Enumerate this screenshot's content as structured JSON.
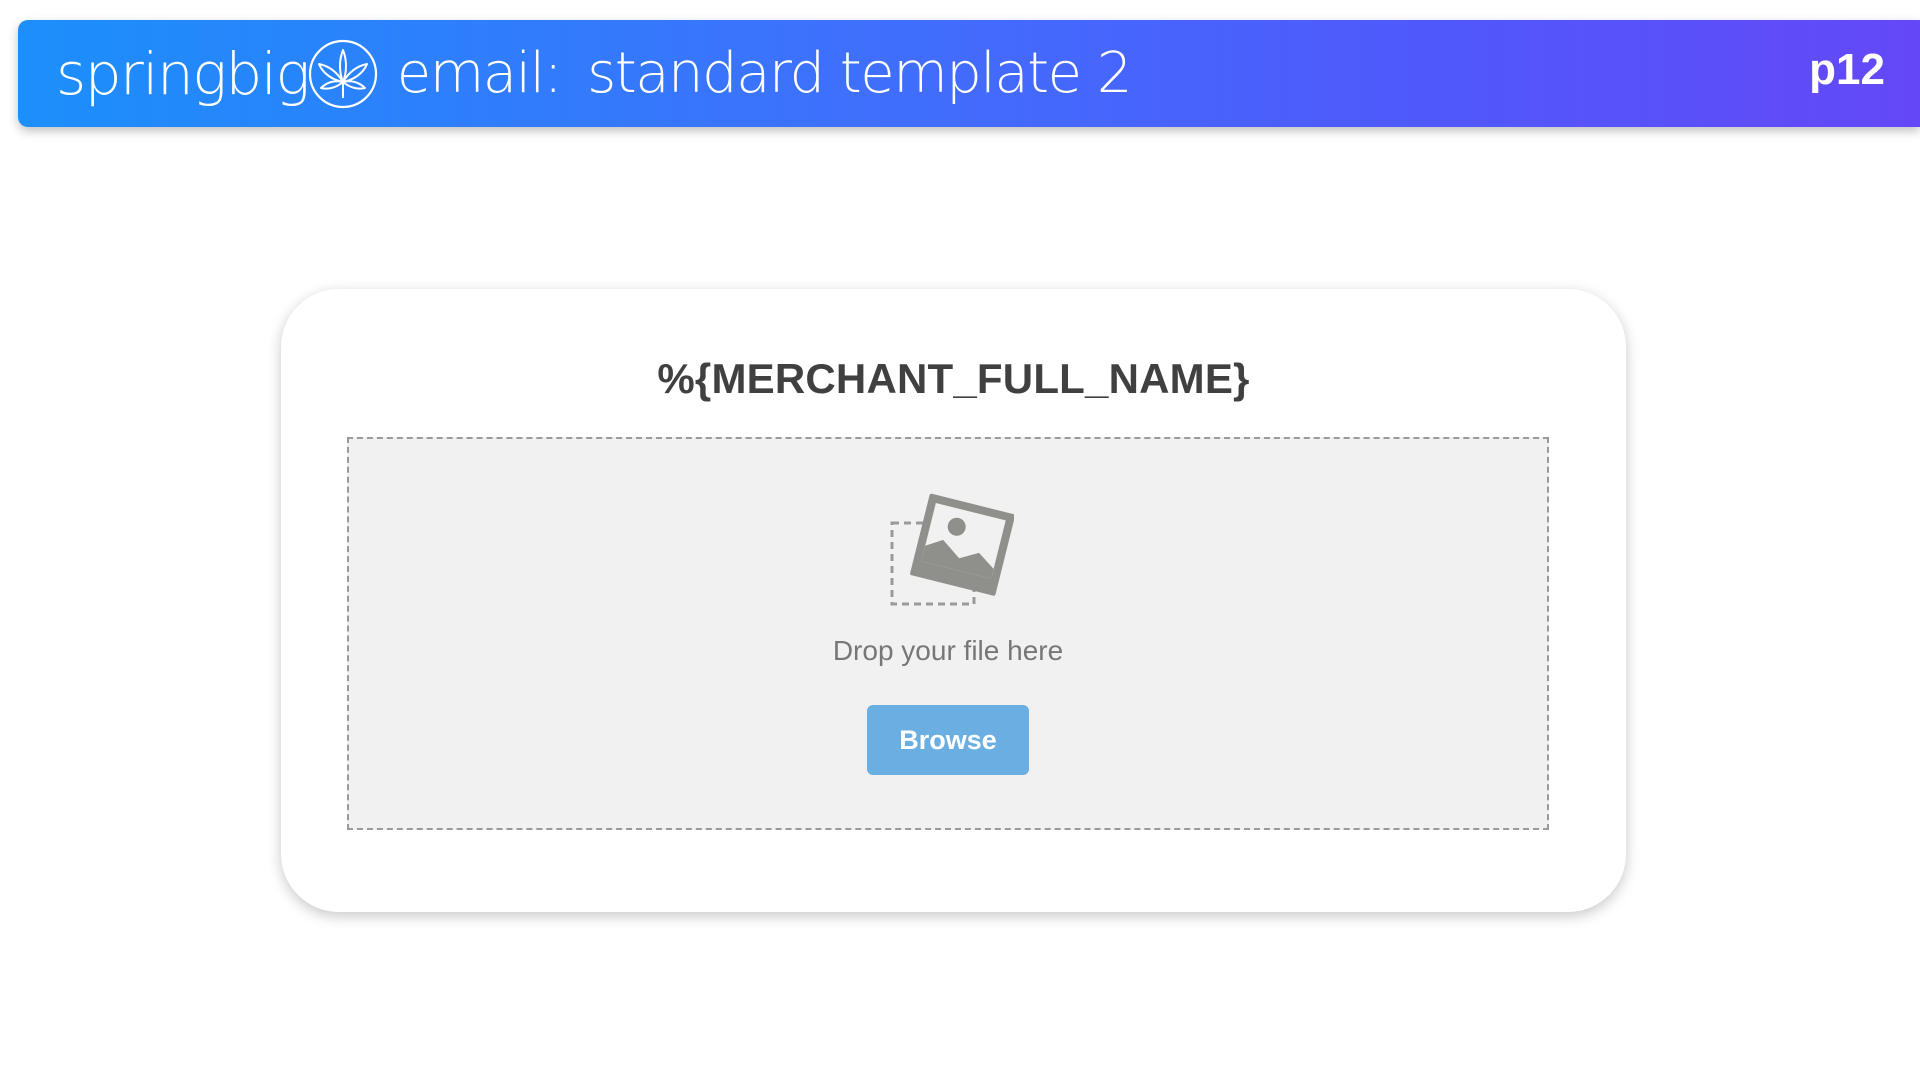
{
  "header": {
    "brand": "springbig",
    "brand_icon": "cannabis-leaf-icon",
    "title_prefix": "email:",
    "title": "standard template 2",
    "page_number": "p12",
    "gradient_colors": [
      "#1c8ffb",
      "#6448f7"
    ]
  },
  "card": {
    "merchant_name": "%{MERCHANT_FULL_NAME}",
    "dropzone": {
      "icon": "image-placeholder-icon",
      "text": "Drop your file here",
      "browse_label": "Browse",
      "button_color": "#6aaee2"
    }
  }
}
